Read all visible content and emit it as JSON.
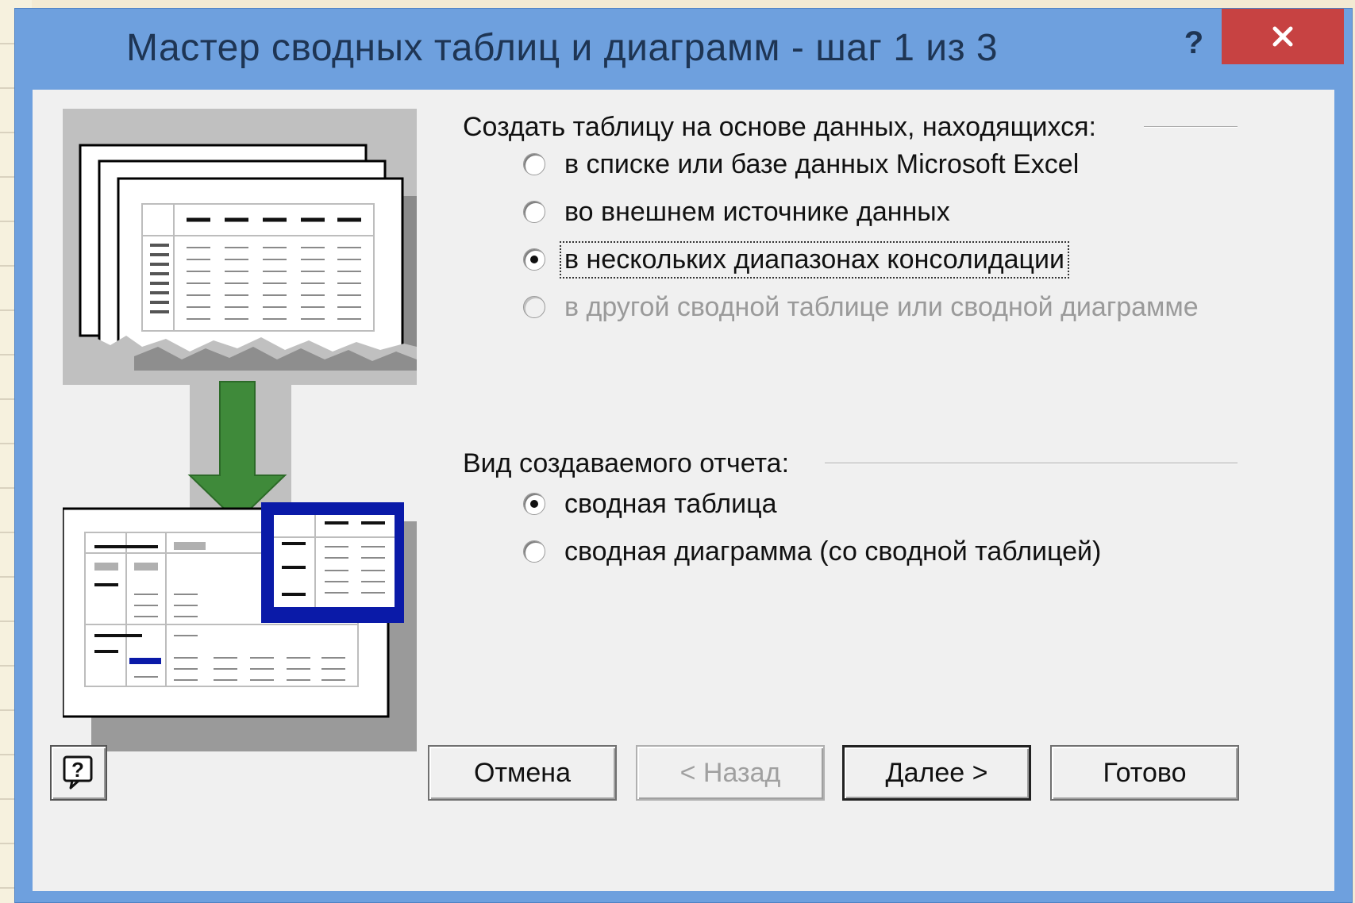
{
  "window": {
    "title": "Мастер сводных таблиц и диаграмм - шаг 1 из 3",
    "help_glyph": "?",
    "close_icon": "close-icon"
  },
  "source_group": {
    "label": "Создать таблицу на основе данных, находящихся:",
    "options": [
      {
        "label": "в списке или базе данных Microsoft Excel",
        "selected": false,
        "disabled": false
      },
      {
        "label": "во внешнем источнике данных",
        "selected": false,
        "disabled": false
      },
      {
        "label": "в нескольких диапазонах консолидации",
        "selected": true,
        "disabled": false
      },
      {
        "label": "в другой сводной таблице или сводной диаграмме",
        "selected": false,
        "disabled": true
      }
    ]
  },
  "report_group": {
    "label": "Вид создаваемого отчета:",
    "options": [
      {
        "label": "сводная таблица",
        "selected": true,
        "disabled": false
      },
      {
        "label": "сводная диаграмма (со сводной таблицей)",
        "selected": false,
        "disabled": false
      }
    ]
  },
  "buttons": {
    "cancel": "Отмена",
    "back": "< Назад",
    "next": "Далее >",
    "finish": "Готово"
  },
  "colors": {
    "titlebar": "#6ea0de",
    "close": "#c74242",
    "arrow": "#3f8a3a",
    "frame": "#0a1aa8"
  }
}
